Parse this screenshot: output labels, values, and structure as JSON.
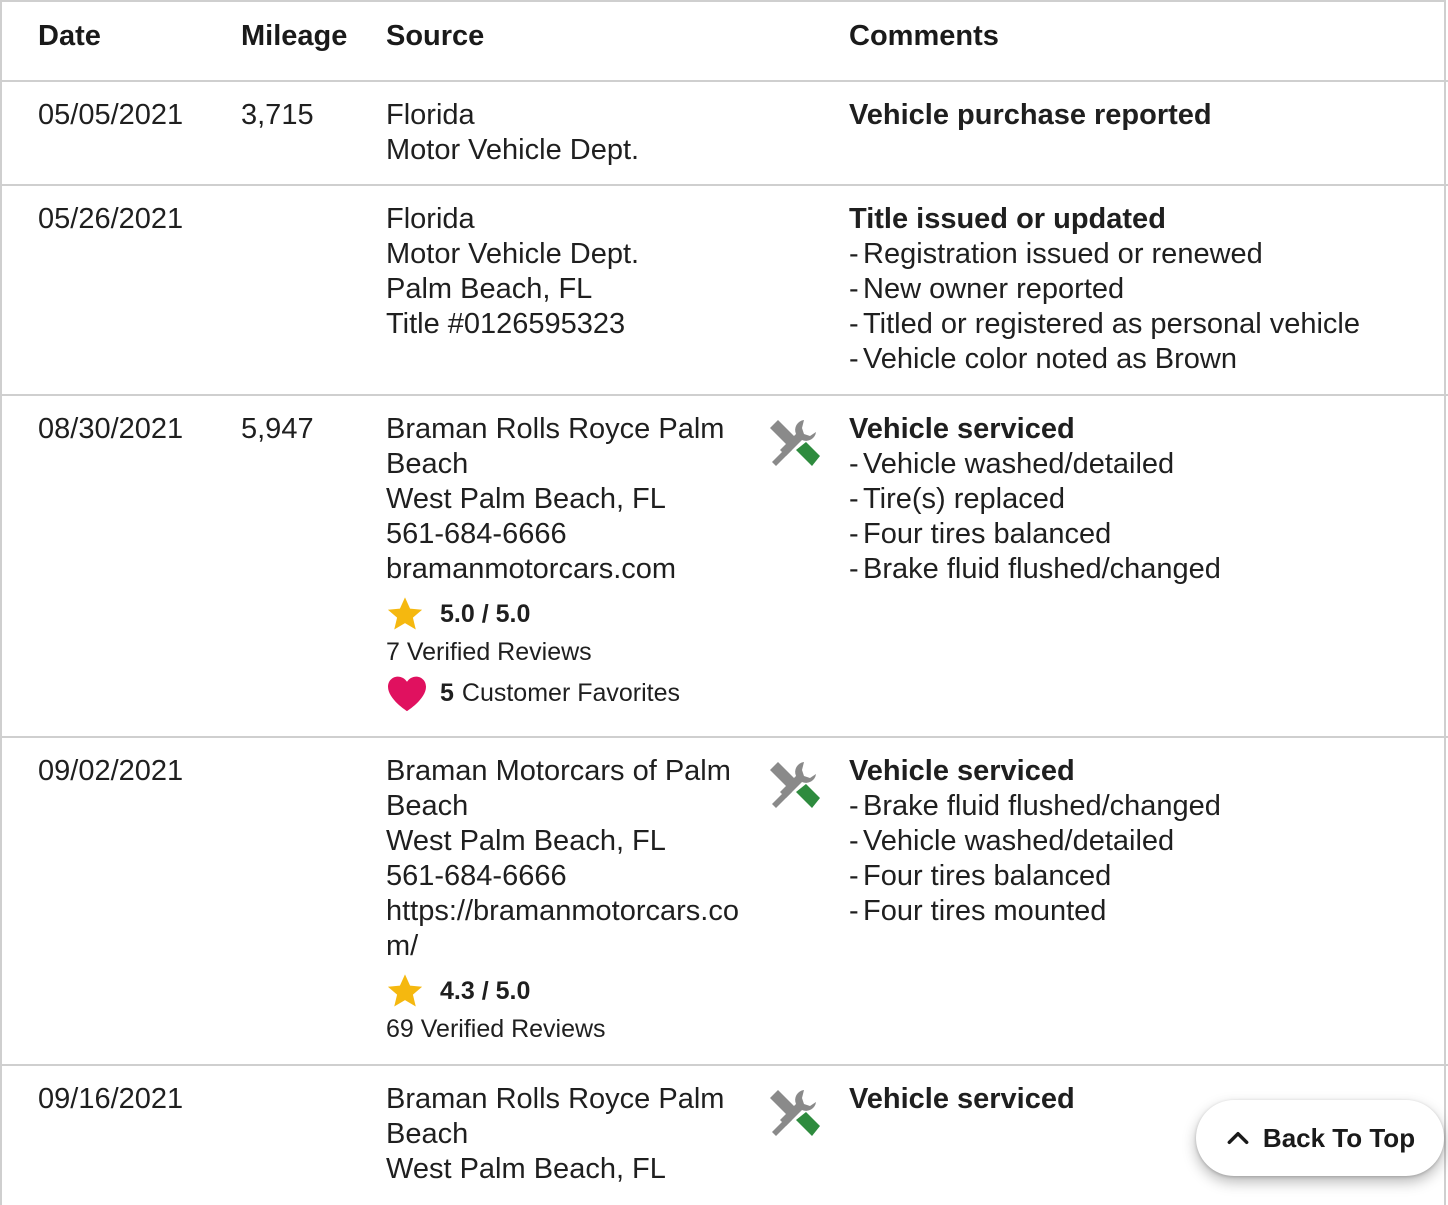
{
  "header": {
    "date": "Date",
    "mileage": "Mileage",
    "source": "Source",
    "comments": "Comments"
  },
  "rows": [
    {
      "date": "05/05/2021",
      "mileage": "3,715",
      "source": [
        "Florida",
        "Motor Vehicle Dept."
      ],
      "comment_title": "Vehicle purchase reported",
      "comment_items": []
    },
    {
      "date": "05/26/2021",
      "mileage": "",
      "source": [
        "Florida",
        "Motor Vehicle Dept.",
        "Palm Beach, FL",
        "Title #0126595323"
      ],
      "comment_title": "Title issued or updated",
      "comment_items": [
        "Registration issued or renewed",
        "New owner reported",
        "Titled or registered as personal vehicle",
        "Vehicle color noted as Brown"
      ]
    },
    {
      "date": "08/30/2021",
      "mileage": "5,947",
      "source": [
        "Braman Rolls Royce Palm Beach",
        "West Palm Beach, FL",
        "561-684-6666",
        "bramanmotorcars.com"
      ],
      "rating": "5.0 / 5.0",
      "reviews": "7 Verified Reviews",
      "favorites_count": "5",
      "favorites_label": "Customer Favorites",
      "icon": "service-tools-icon",
      "comment_title": "Vehicle serviced",
      "comment_items": [
        "Vehicle washed/detailed",
        "Tire(s) replaced",
        "Four tires balanced",
        "Brake fluid flushed/changed"
      ]
    },
    {
      "date": "09/02/2021",
      "mileage": "",
      "source": [
        "Braman Motorcars of Palm Beach",
        "West Palm Beach, FL",
        "561-684-6666",
        "https://bramanmotorcars.com/"
      ],
      "rating": "4.3 / 5.0",
      "reviews": "69 Verified Reviews",
      "icon": "service-tools-icon",
      "comment_title": "Vehicle serviced",
      "comment_items": [
        "Brake fluid flushed/changed",
        "Vehicle washed/detailed",
        "Four tires balanced",
        "Four tires mounted"
      ]
    },
    {
      "date": "09/16/2021",
      "mileage": "",
      "source": [
        "Braman Rolls Royce Palm Beach",
        "West Palm Beach, FL"
      ],
      "icon": "service-tools-icon",
      "comment_title": "Vehicle serviced",
      "comment_items": []
    }
  ],
  "back_to_top": "Back To Top",
  "colors": {
    "star": "#f5b80f",
    "heart": "#e0115f",
    "wrench_green": "#2e8b3e",
    "tool_gray": "#8a8a8a",
    "border": "#cfcfcf"
  }
}
